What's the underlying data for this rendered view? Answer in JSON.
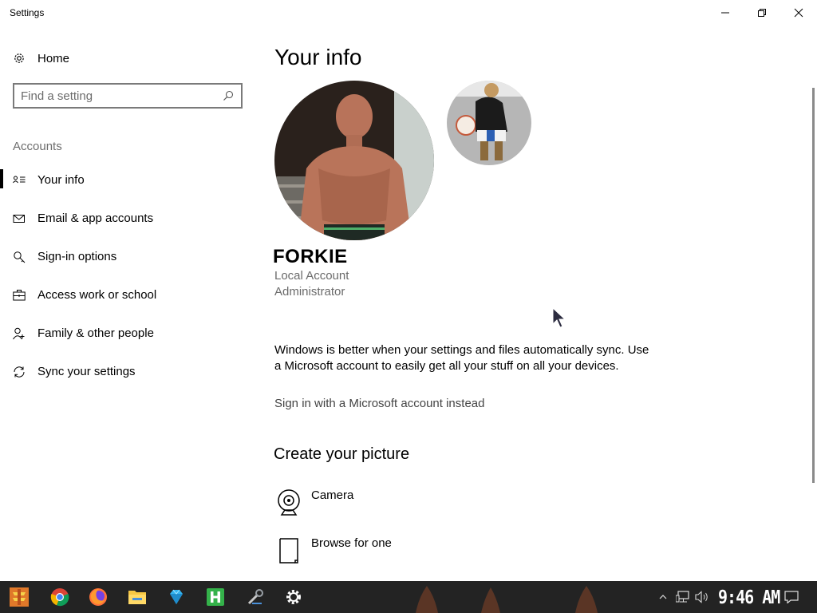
{
  "window": {
    "title": "Settings"
  },
  "sidebar": {
    "home_label": "Home",
    "search_placeholder": "Find a setting",
    "section": "Accounts",
    "items": [
      {
        "label": "Your info",
        "icon": "contact-card-icon",
        "selected": true
      },
      {
        "label": "Email & app accounts",
        "icon": "mail-icon"
      },
      {
        "label": "Sign-in options",
        "icon": "key-icon"
      },
      {
        "label": "Access work or school",
        "icon": "briefcase-icon"
      },
      {
        "label": "Family & other people",
        "icon": "person-add-icon"
      },
      {
        "label": "Sync your settings",
        "icon": "sync-icon"
      }
    ]
  },
  "main": {
    "heading": "Your info",
    "user_name": "FORKIE",
    "account_type": "Local Account",
    "account_role": "Administrator",
    "sync_text": "Windows is better when your settings and files automatically sync. Use a Microsoft account to easily get all your stuff on all your devices.",
    "ms_link": "Sign in with a Microsoft account instead",
    "create_heading": "Create your picture",
    "options": [
      {
        "label": "Camera",
        "icon": "camera-icon"
      },
      {
        "label": "Browse for one",
        "icon": "document-icon"
      }
    ]
  },
  "taskbar": {
    "clock": "9:46 AM",
    "apps": [
      "start-icon",
      "chrome-icon",
      "firefox-icon",
      "file-explorer-icon",
      "diamond-app-icon",
      "h-app-icon",
      "tools-app-icon",
      "settings-icon"
    ]
  },
  "colors": {
    "taskbar": "#232323",
    "accent_bar": "#000000",
    "muted_text": "#6b6b6b"
  }
}
